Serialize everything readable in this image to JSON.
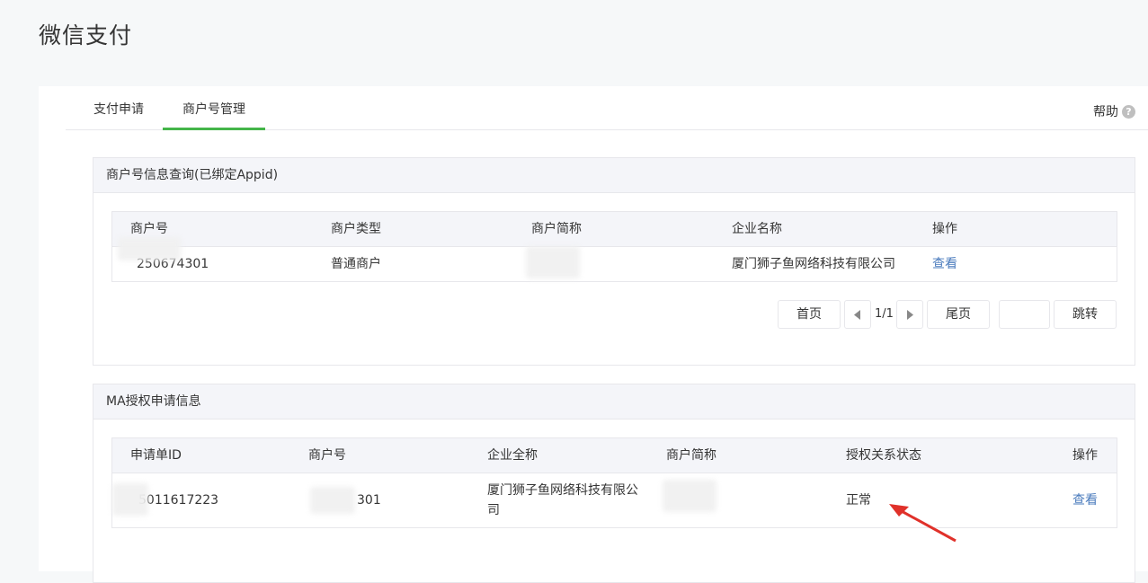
{
  "page": {
    "title": "微信支付"
  },
  "tabs": [
    {
      "label": "支付申请",
      "active": false
    },
    {
      "label": "商户号管理",
      "active": true
    }
  ],
  "help": {
    "label": "帮助",
    "icon": "question-circle-icon"
  },
  "merchant_section": {
    "title": "商户号信息查询(已绑定Appid)",
    "columns": [
      "商户号",
      "商户类型",
      "商户简称",
      "企业名称",
      "操作"
    ],
    "rows": [
      {
        "merchant_id": "250674301",
        "type": "普通商户",
        "short_name": "",
        "company": "厦门狮子鱼网络科技有限公司",
        "action": "查看"
      }
    ],
    "pager": {
      "first": "首页",
      "page_count": "1/1",
      "last": "尾页",
      "jump": "跳转"
    }
  },
  "ma_section": {
    "title": "MA授权申请信息",
    "columns": [
      "申请单ID",
      "商户号",
      "企业全称",
      "商户简称",
      "授权关系状态",
      "操作"
    ],
    "rows": [
      {
        "apply_id": "5011617223",
        "merchant_id": "301",
        "company_full": "厦门狮子鱼网络科技有限公司",
        "short_name": "",
        "status": "正常",
        "action": "查看"
      }
    ]
  },
  "colors": {
    "accent_green": "#44b549",
    "link_blue": "#4a7bbd",
    "annotation_red": "#e0312a"
  }
}
